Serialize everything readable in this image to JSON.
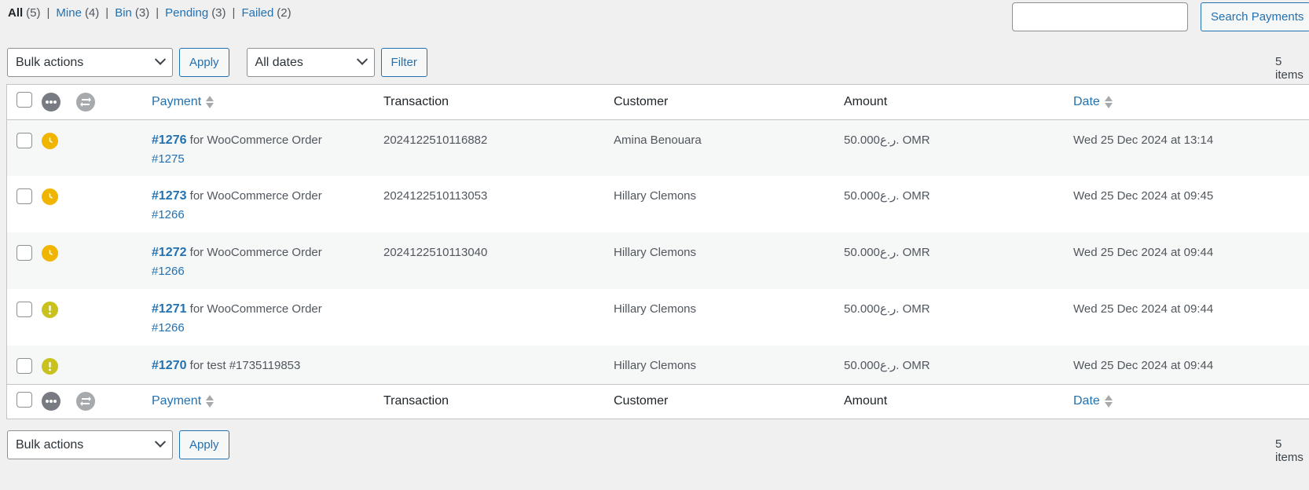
{
  "views": [
    {
      "label": "All",
      "count": "(5)"
    },
    {
      "label": "Mine",
      "count": "(4)"
    },
    {
      "label": "Bin",
      "count": "(3)"
    },
    {
      "label": "Pending",
      "count": "(3)"
    },
    {
      "label": "Failed",
      "count": "(2)"
    }
  ],
  "search": {
    "button_label": "Search Payments",
    "value": ""
  },
  "tablenav_top": {
    "bulk_label": "Bulk actions",
    "apply_label": "Apply",
    "dates_label": "All dates",
    "filter_label": "Filter",
    "items_count": "5 items"
  },
  "tablenav_bottom": {
    "bulk_label": "Bulk actions",
    "apply_label": "Apply",
    "items_count": "5 items"
  },
  "columns": {
    "payment": "Payment",
    "transaction": "Transaction",
    "customer": "Customer",
    "amount": "Amount",
    "date": "Date"
  },
  "rows": [
    {
      "id": "#1276",
      "desc": "for WooCommerce Order",
      "order": "#1275",
      "transaction": "2024122510116882",
      "customer": "Amina Benouara",
      "amount": "50.000ر.ع. OMR",
      "date": "Wed 25 Dec 2024 at 13:14",
      "status_icon": "clock-icon"
    },
    {
      "id": "#1273",
      "desc": "for WooCommerce Order",
      "order": "#1266",
      "transaction": "2024122510113053",
      "customer": "Hillary Clemons",
      "amount": "50.000ر.ع. OMR",
      "date": "Wed 25 Dec 2024 at 09:45",
      "status_icon": "clock-icon"
    },
    {
      "id": "#1272",
      "desc": "for WooCommerce Order",
      "order": "#1266",
      "transaction": "2024122510113040",
      "customer": "Hillary Clemons",
      "amount": "50.000ر.ع. OMR",
      "date": "Wed 25 Dec 2024 at 09:44",
      "status_icon": "clock-icon"
    },
    {
      "id": "#1271",
      "desc": "for WooCommerce Order",
      "order": "#1266",
      "transaction": "",
      "customer": "Hillary Clemons",
      "amount": "50.000ر.ع. OMR",
      "date": "Wed 25 Dec 2024 at 09:44",
      "status_icon": "exclamation-icon"
    },
    {
      "id": "#1270",
      "desc": "for test #1735119853",
      "order": "",
      "transaction": "",
      "customer": "Hillary Clemons",
      "amount": "50.000ر.ع. OMR",
      "date": "Wed 25 Dec 2024 at 09:44",
      "status_icon": "exclamation-icon"
    }
  ],
  "colors": {
    "link": "#2271b1",
    "pending": "#f0b500",
    "failed": "#c9c21e",
    "header_icon": "#787c82"
  }
}
